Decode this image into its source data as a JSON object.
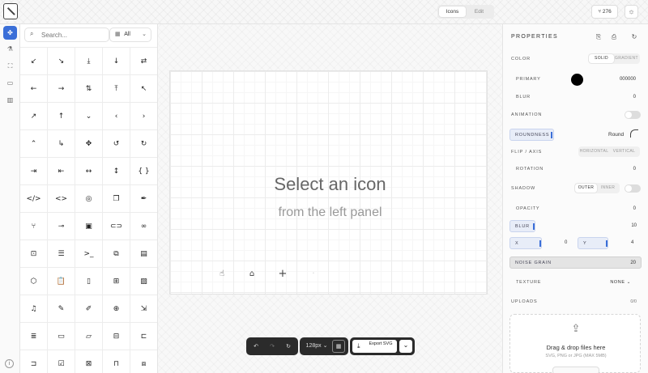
{
  "header": {
    "mode_tabs": [
      "Icons",
      "Edit"
    ],
    "github_stars": "276",
    "github_icon": "github-icon",
    "theme_icon": "sun-icon"
  },
  "rail": {
    "items": [
      "icon-set-icon",
      "flask-icon",
      "scan-icon",
      "paint-roller-icon",
      "book-icon"
    ],
    "info_icon": "info-icon"
  },
  "panel": {
    "search_placeholder": "Search...",
    "filter_value": "All",
    "icons": [
      {
        "name": "arrow-down-left",
        "glyph": "↙"
      },
      {
        "name": "arrow-down-right",
        "glyph": "↘"
      },
      {
        "name": "arrow-down-to-line",
        "glyph": "⤓"
      },
      {
        "name": "arrow-down",
        "glyph": "↓"
      },
      {
        "name": "arrow-left-right",
        "glyph": "⇄"
      },
      {
        "name": "arrow-left",
        "glyph": "←"
      },
      {
        "name": "arrow-right",
        "glyph": "→"
      },
      {
        "name": "arrow-up-down",
        "glyph": "⇅"
      },
      {
        "name": "arrow-up-from-line",
        "glyph": "⤒"
      },
      {
        "name": "arrow-up-left",
        "glyph": "↖"
      },
      {
        "name": "arrow-up-right",
        "glyph": "↗"
      },
      {
        "name": "arrow-up",
        "glyph": "↑"
      },
      {
        "name": "chevron-down",
        "glyph": "⌄"
      },
      {
        "name": "chevron-left",
        "glyph": "‹"
      },
      {
        "name": "chevron-right",
        "glyph": "›"
      },
      {
        "name": "chevron-up",
        "glyph": "⌃"
      },
      {
        "name": "corner-down-right",
        "glyph": "↳"
      },
      {
        "name": "move",
        "glyph": "✥"
      },
      {
        "name": "rotate-ccw",
        "glyph": "↺"
      },
      {
        "name": "rotate-cw",
        "glyph": "↻"
      },
      {
        "name": "skip-forward",
        "glyph": "⇥"
      },
      {
        "name": "skip-back",
        "glyph": "⇤"
      },
      {
        "name": "move-horizontal",
        "glyph": "↔"
      },
      {
        "name": "move-vertical",
        "glyph": "↕"
      },
      {
        "name": "braces",
        "glyph": "{ }"
      },
      {
        "name": "code-xml",
        "glyph": "</>"
      },
      {
        "name": "code",
        "glyph": "<>"
      },
      {
        "name": "compass",
        "glyph": "◎"
      },
      {
        "name": "copy",
        "glyph": "❐"
      },
      {
        "name": "pen-tool",
        "glyph": "✒"
      },
      {
        "name": "git-branch",
        "glyph": "⑂"
      },
      {
        "name": "git-commit",
        "glyph": "⊸"
      },
      {
        "name": "scan-face",
        "glyph": "▣"
      },
      {
        "name": "link-2",
        "glyph": "⊂⊃"
      },
      {
        "name": "link",
        "glyph": "∞"
      },
      {
        "name": "square-code",
        "glyph": "⊡"
      },
      {
        "name": "server",
        "glyph": "☰"
      },
      {
        "name": "terminal",
        "glyph": ">_"
      },
      {
        "name": "workflow",
        "glyph": "⧉"
      },
      {
        "name": "archive",
        "glyph": "▤"
      },
      {
        "name": "box",
        "glyph": "⬡"
      },
      {
        "name": "clipboard-list",
        "glyph": "📋"
      },
      {
        "name": "clipboard",
        "glyph": "▯"
      },
      {
        "name": "file-plus",
        "glyph": "⊞"
      },
      {
        "name": "file-image",
        "glyph": "▨"
      },
      {
        "name": "file-audio",
        "glyph": "♫"
      },
      {
        "name": "file-pen",
        "glyph": "✎"
      },
      {
        "name": "file-edit",
        "glyph": "✐"
      },
      {
        "name": "file-plus-2",
        "glyph": "⊕"
      },
      {
        "name": "file-input",
        "glyph": "⇲"
      },
      {
        "name": "file-text",
        "glyph": "≣"
      },
      {
        "name": "file",
        "glyph": "▭"
      },
      {
        "name": "folder",
        "glyph": "▱"
      },
      {
        "name": "folder-plus",
        "glyph": "⊟"
      },
      {
        "name": "folder-open",
        "glyph": "⊏"
      },
      {
        "name": "folder-input",
        "glyph": "⊐"
      },
      {
        "name": "folder-check",
        "glyph": "☑"
      },
      {
        "name": "folder-edit",
        "glyph": "⊠"
      },
      {
        "name": "folder-closed",
        "glyph": "⊓"
      },
      {
        "name": "copy-plus",
        "glyph": "⧈"
      }
    ]
  },
  "canvas": {
    "empty_title": "Select an icon",
    "empty_subtitle": "from the left panel",
    "quick_action_icons": [
      "touch-icon",
      "inbox-icon",
      "plus-icon",
      "dot-icon"
    ],
    "toolbar": {
      "undo_icon": "undo-icon",
      "redo_icon": "redo-icon",
      "reset_icon": "refresh-icon",
      "size": "128px",
      "grid_icon": "grid-icon",
      "export_label": "Export SVG",
      "export_menu_icon": "chevron-down-icon"
    }
  },
  "properties": {
    "title": "PROPERTIES",
    "color_label": "COLOR",
    "color_tabs": [
      "SOLID",
      "GRADIENT"
    ],
    "primary_label": "PRIMARY",
    "primary_hex": "000000",
    "primary_color": "#000000",
    "blur_label": "BLUR",
    "blur_value": "0",
    "animation_label": "ANIMATION",
    "animation_on": false,
    "roundness_label": "ROUNDNESS",
    "roundness_value": "Round",
    "flip_label": "FLIP / AXIS",
    "flip_tabs": [
      "HORIZONTAL",
      "VERTICAL"
    ],
    "rotation_label": "ROTATION",
    "rotation_value": "0",
    "shadow_label": "SHADOW",
    "shadow_tabs": [
      "OUTER",
      "INNER"
    ],
    "shadow_on": false,
    "opacity_label": "OPACITY",
    "opacity_value": "0",
    "shadow_blur_label": "BLUR",
    "shadow_blur_value": "10",
    "x_label": "X",
    "x_value": "0",
    "y_label": "Y",
    "y_value": "4",
    "noise_label": "NOISE GRAIN",
    "noise_value": "20",
    "texture_label": "TEXTURE",
    "texture_value": "NONE",
    "uploads_label": "UPLOADS",
    "uploads_count": "0/0",
    "dropzone_title": "Drag & drop files here",
    "dropzone_sub": "SVG, PNG or JPG (MAX 5MB)",
    "accent_color": "#3b6fd8"
  }
}
